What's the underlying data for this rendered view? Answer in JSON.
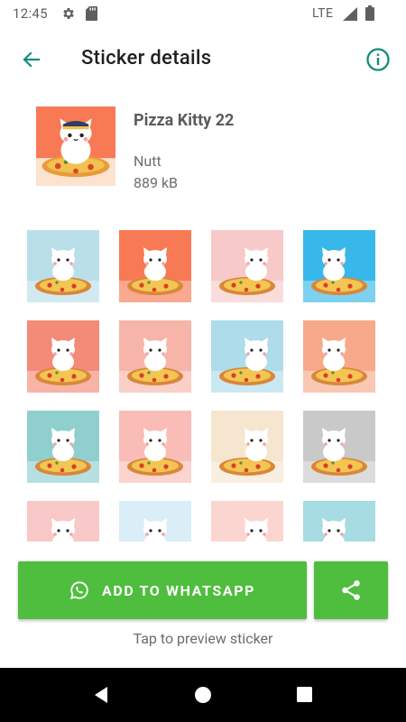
{
  "status_bar": {
    "time": "12:45",
    "network": "LTE",
    "icons": [
      "gear-icon",
      "sd-card-icon",
      "signal-icon",
      "battery-icon"
    ]
  },
  "app_bar": {
    "title": "Sticker details",
    "back_icon": "arrow-left-icon",
    "info_icon": "info-icon",
    "accent_color": "#128c7e"
  },
  "pack": {
    "name": "Pizza Kitty 22",
    "author": "Nutt",
    "size": "889 kB"
  },
  "stickers": [
    {
      "name": "sticker-1",
      "bg": "#b9dfe9"
    },
    {
      "name": "sticker-2",
      "bg": "#f77a55"
    },
    {
      "name": "sticker-3",
      "bg": "#f7c9c9"
    },
    {
      "name": "sticker-4",
      "bg": "#38b8ea"
    },
    {
      "name": "sticker-5",
      "bg": "#f48a78"
    },
    {
      "name": "sticker-6",
      "bg": "#f7b5a9"
    },
    {
      "name": "sticker-7",
      "bg": "#aedcea"
    },
    {
      "name": "sticker-8",
      "bg": "#f8a98a"
    },
    {
      "name": "sticker-9",
      "bg": "#8fd0cf"
    },
    {
      "name": "sticker-10",
      "bg": "#f9bcb6"
    },
    {
      "name": "sticker-11",
      "bg": "#f6e6cf"
    },
    {
      "name": "sticker-12",
      "bg": "#c9c9c9"
    },
    {
      "name": "sticker-13",
      "bg": "#f9c8c8"
    },
    {
      "name": "sticker-14",
      "bg": "#d9eef7"
    },
    {
      "name": "sticker-15",
      "bg": "#fbd6d0"
    },
    {
      "name": "sticker-16",
      "bg": "#a7dce3"
    }
  ],
  "actions": {
    "add_label": "ADD TO WHATSAPP",
    "add_icon": "whatsapp-icon",
    "share_icon": "share-icon",
    "button_color": "#4fbd3d"
  },
  "hint": "Tap to preview sticker",
  "nav_bar": {
    "icons": [
      "nav-back-icon",
      "nav-home-icon",
      "nav-recents-icon"
    ]
  }
}
